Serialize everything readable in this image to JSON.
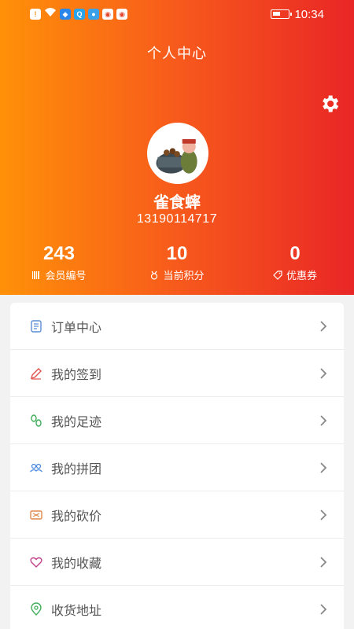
{
  "status_bar": {
    "time": "10:34"
  },
  "header": {
    "title": "个人中心",
    "username": "雀食蟀",
    "phone": "13190114717"
  },
  "stats": [
    {
      "value": "243",
      "label": "会员编号",
      "icon": "barcode-icon"
    },
    {
      "value": "10",
      "label": "当前积分",
      "icon": "medal-icon"
    },
    {
      "value": "0",
      "label": "优惠券",
      "icon": "coupon-icon"
    }
  ],
  "menu": {
    "items": [
      {
        "label": "订单中心",
        "icon": "order-icon",
        "color": "#5b8fd6"
      },
      {
        "label": "我的签到",
        "icon": "pencil-icon",
        "color": "#e0504d"
      },
      {
        "label": "我的足迹",
        "icon": "footprint-icon",
        "color": "#3fae5a"
      },
      {
        "label": "我的拼团",
        "icon": "group-icon",
        "color": "#4a8be0"
      },
      {
        "label": "我的砍价",
        "icon": "bargain-icon",
        "color": "#e0894a"
      },
      {
        "label": "我的收藏",
        "icon": "heart-icon",
        "color": "#c0448a"
      },
      {
        "label": "收货地址",
        "icon": "location-icon",
        "color": "#3fae5a"
      }
    ]
  },
  "colors": {
    "header_start": "#ff9108",
    "header_end": "#e92626"
  }
}
